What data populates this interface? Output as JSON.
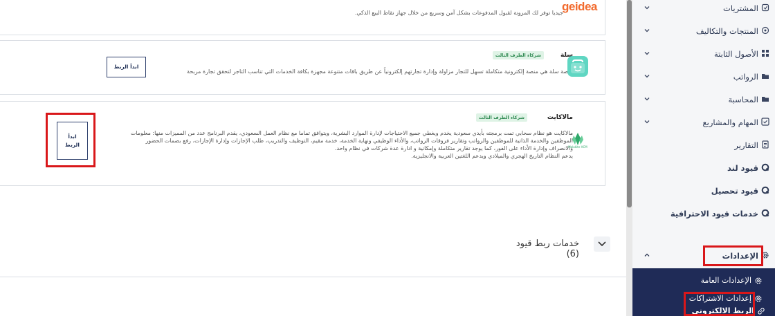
{
  "integrations": [
    {
      "brand": "geidea",
      "description": "جيديا توفر لك المرونة لقبول المدفوعات بشكل آمن وسريع من خلال جهاز نقاط البيع الذكي."
    },
    {
      "name": "سلة",
      "badge": "شركاء الطرف الثالث",
      "description": "منصة سلة هي منصة إلكترونية متكاملة تسهل للتجار مزاولة وإدارة تجارتهم إلكترونياً عن طريق باقات متنوعة مجهزة بكافة الخدمات التي تناسب التاجر لتحقق تجارة مربحة",
      "button": "ابدأ الربط"
    },
    {
      "name": "مالاكايت",
      "badge": "شركاء الطرف الثالث",
      "description_lines": [
        "مالاكايت هو نظام سحابي تمت برمجته بأيدي سعودية يخدم ويغطي جميع الاحتياجات لإدارة الموارد البشرية، ويتوافق تماما مع نظام العمل السعودي، يقدم البرنامج عدد من المميزات منها: معلومات",
        "الموظفين والخدمة الذاتية للموظفين والرواتب وتقارير فروقات الرواتب، والأداء الوظيفي ونهاية الخدمة، خدمة مقيم، التوظيف والتدريب، طلب الإجازات وإدارة الإجازات، رفع بصمات الحضور",
        "والانصراف وإدارة الأداء على الفور، كما يوجد تقارير متكاملة وإمكانية و ادارة عدة شركات في نظام واحد.",
        "يدعم النظام التاريخ الهجري والميلادي ويدعم اللغتين العربية والانجليزية."
      ],
      "button_line1": "ابدأ",
      "button_line2": "الربط",
      "logo_caption": "Malakite HCM"
    }
  ],
  "services": {
    "title": "خدمات ربط قيود (6)"
  },
  "sidebar": {
    "items": [
      {
        "label": "المشتريات",
        "icon": "purchases-icon"
      },
      {
        "label": "المنتجات والتكاليف",
        "icon": "products-icon"
      },
      {
        "label": "الأصول الثابتة",
        "icon": "assets-icon"
      },
      {
        "label": "الرواتب",
        "icon": "payroll-icon"
      },
      {
        "label": "المحاسبة",
        "icon": "accounting-icon"
      },
      {
        "label": "المهام والمشاريع",
        "icon": "tasks-icon"
      },
      {
        "label": "التقارير",
        "icon": "reports-icon"
      },
      {
        "label": "قيود لند",
        "icon": "qoyod-lend-icon"
      },
      {
        "label": "قيود تحصيل",
        "icon": "qoyod-collect-icon"
      },
      {
        "label": "خدمات قيود الاحترافية",
        "icon": "pro-services-icon"
      },
      {
        "label": "الإعدادات",
        "icon": "settings-icon"
      }
    ],
    "submenu": [
      {
        "label": "الإعدادات العامة",
        "icon": "gear-icon"
      },
      {
        "label": "إعدادات الاشتراكات",
        "icon": "gear-icon"
      },
      {
        "label": "الربط الالكتروني",
        "icon": "link-icon"
      }
    ]
  },
  "colors": {
    "sidebar_active_bg": "#1f2b57",
    "highlight": "#d9171a",
    "badge_bg": "#dff3e6",
    "geidea": "#f26b2e"
  }
}
